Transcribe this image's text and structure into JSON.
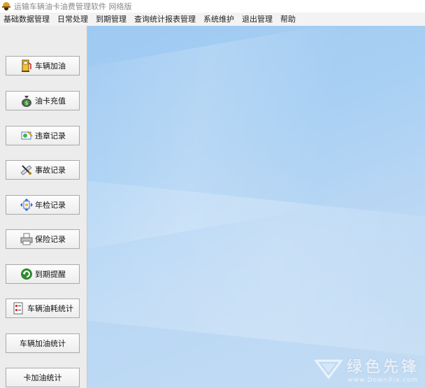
{
  "window": {
    "title": "运输车辆油卡油费管理软件  网络版"
  },
  "menu": [
    "基础数据管理",
    "日常处理",
    "到期管理",
    "查询统计报表管理",
    "系统维护",
    "退出管理",
    "帮助"
  ],
  "sidebar": {
    "items": [
      {
        "label": "车辆加油",
        "icon": "fuel-pump-icon"
      },
      {
        "label": "油卡充值",
        "icon": "money-bag-icon"
      },
      {
        "label": "违章记录",
        "icon": "violation-note-icon"
      },
      {
        "label": "事故记录",
        "icon": "accident-tools-icon"
      },
      {
        "label": "年检记录",
        "icon": "inspection-arrows-icon"
      },
      {
        "label": "保险记录",
        "icon": "printer-icon"
      },
      {
        "label": "到期提醒",
        "icon": "refresh-icon"
      },
      {
        "label": "车辆油耗统计",
        "icon": "checklist-icon"
      },
      {
        "label": "车辆加油统计",
        "icon": ""
      },
      {
        "label": "卡加油统计",
        "icon": ""
      }
    ]
  },
  "watermark": {
    "title": "绿色先锋",
    "url": "www.DownXia.com"
  }
}
